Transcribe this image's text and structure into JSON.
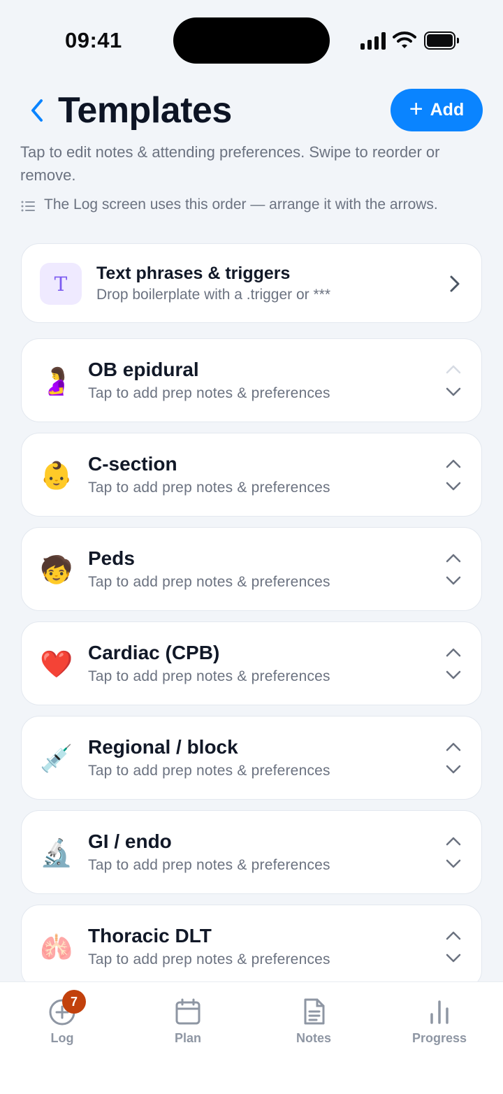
{
  "status_bar": {
    "time": "09:41"
  },
  "header": {
    "title": "Templates",
    "add_label": "Add",
    "subtitle": "Tap to edit notes & attending preferences. Swipe to reorder or remove.",
    "hint": "The Log screen uses this order — arrange it with the arrows."
  },
  "phrases_card": {
    "badge": "T",
    "title": "Text phrases & triggers",
    "subtitle": "Drop boilerplate with a .trigger or ***"
  },
  "templates": [
    {
      "emoji": "🤰",
      "icon": "pregnant-woman-icon",
      "title": "OB epidural",
      "subtitle": "Tap to add prep notes & preferences",
      "up_disabled": true
    },
    {
      "emoji": "👶",
      "icon": "baby-icon",
      "title": "C-section",
      "subtitle": "Tap to add prep notes & preferences",
      "up_disabled": false
    },
    {
      "emoji": "🧒",
      "icon": "child-icon",
      "title": "Peds",
      "subtitle": "Tap to add prep notes & preferences",
      "up_disabled": false
    },
    {
      "emoji": "❤️",
      "icon": "heart-icon",
      "title": "Cardiac (CPB)",
      "subtitle": "Tap to add prep notes & preferences",
      "up_disabled": false
    },
    {
      "emoji": "💉",
      "icon": "syringe-icon",
      "title": "Regional / block",
      "subtitle": "Tap to add prep notes & preferences",
      "up_disabled": false
    },
    {
      "emoji": "🔬",
      "icon": "microscope-icon",
      "title": "GI / endo",
      "subtitle": "Tap to add prep notes & preferences",
      "up_disabled": false
    },
    {
      "emoji": "🫁",
      "icon": "lungs-icon",
      "title": "Thoracic DLT",
      "subtitle": "Tap to add prep notes & preferences",
      "up_disabled": false
    }
  ],
  "tab_bar": {
    "tabs": [
      {
        "label": "Log",
        "icon": "plus-circle-icon"
      },
      {
        "label": "Plan",
        "icon": "calendar-icon"
      },
      {
        "label": "Notes",
        "icon": "document-icon"
      },
      {
        "label": "Progress",
        "icon": "bar-chart-icon"
      }
    ],
    "log_badge": "7"
  },
  "colors": {
    "accent": "#0a84ff",
    "badge": "#c2410c",
    "background": "#f2f5f9"
  }
}
